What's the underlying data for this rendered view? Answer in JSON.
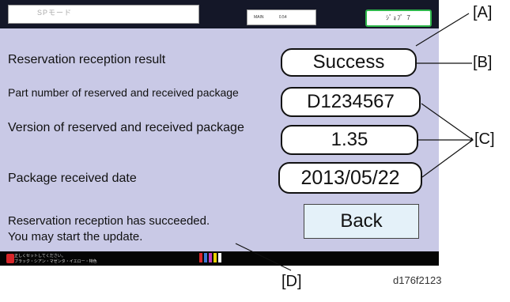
{
  "topbar": {
    "mode_title": "SPモード",
    "info_left": "MAIN",
    "info_right": "0.54",
    "job_label": "ｼﾞｮﾌﾞ 7"
  },
  "fields": [
    {
      "label": "Reservation reception result",
      "value": "Success"
    },
    {
      "label": "Part number of reserved and received package",
      "value": "D1234567"
    },
    {
      "label": "Version of reserved and received package",
      "value": "1.35"
    },
    {
      "label": "Package received date",
      "value": "2013/05/22"
    }
  ],
  "back_button": "Back",
  "message": {
    "line1": "Reservation reception has succeeded.",
    "line2": "You may start the update."
  },
  "footer": {
    "line1": "正しくセットしてください。",
    "line2": "ブラック・シアン・マゼンタ・イエロー・特色",
    "toner_colors": [
      "#d8262a",
      "#3a7bd5",
      "#c23bbd",
      "#e8d200",
      "#ffffff"
    ]
  },
  "callouts": {
    "A": "[A]",
    "B": "[B]",
    "C": "[C]",
    "D": "[D]"
  },
  "figure_id": "d176f2123"
}
